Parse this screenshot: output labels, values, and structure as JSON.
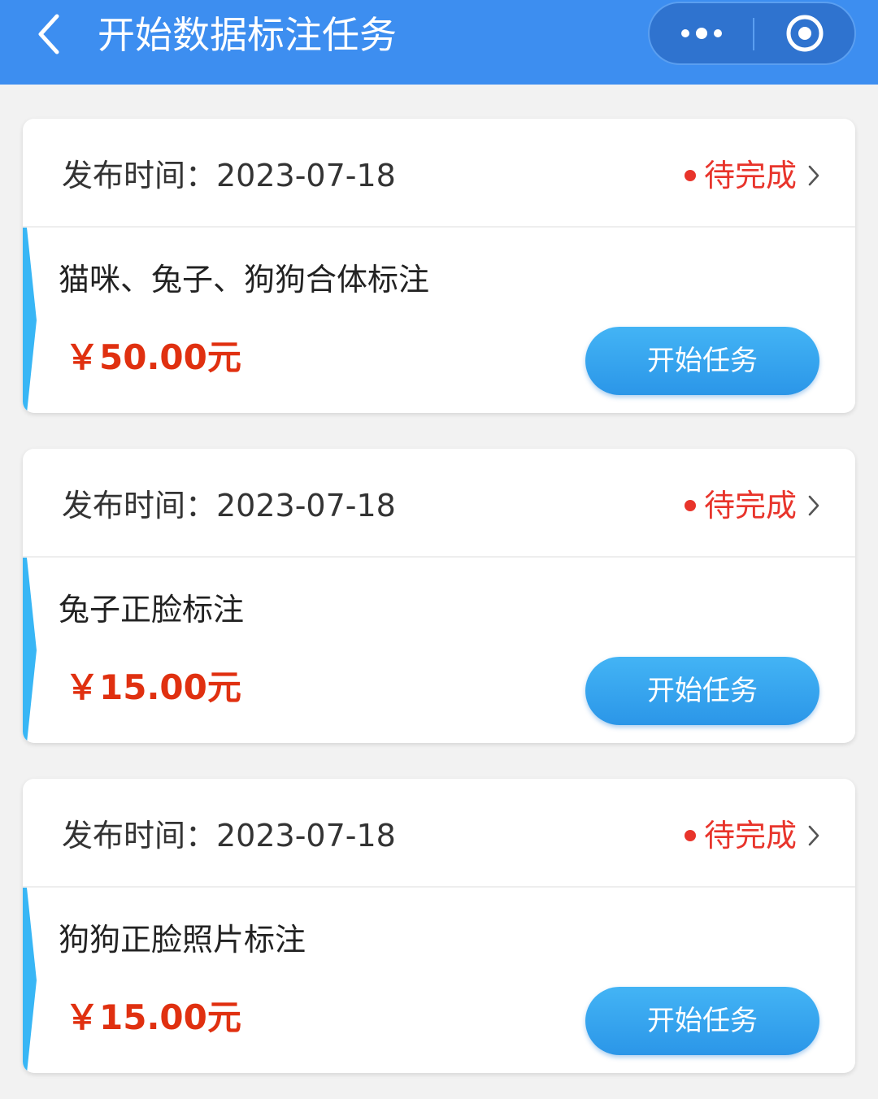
{
  "navbar": {
    "title": "开始数据标注任务",
    "back_icon": "chevron-left-icon",
    "more_icon": "more-dots-icon",
    "close_icon": "target-circle-icon",
    "background": "#3d8ef0"
  },
  "colors": {
    "status_red": "#e8342b",
    "price_red": "#e03010",
    "button_blue": "#2b96e8",
    "accent_blue": "#38b6f5"
  },
  "tasks": [
    {
      "publish_time": "发布时间：2023-07-18",
      "status": "待完成",
      "title": "猫咪、兔子、狗狗合体标注",
      "price": "￥50.00元",
      "button_label": "开始任务"
    },
    {
      "publish_time": "发布时间：2023-07-18",
      "status": "待完成",
      "title": "兔子正脸标注",
      "price": "￥15.00元",
      "button_label": "开始任务"
    },
    {
      "publish_time": "发布时间：2023-07-18",
      "status": "待完成",
      "title": "狗狗正脸照片标注",
      "price": "￥15.00元",
      "button_label": "开始任务"
    }
  ]
}
